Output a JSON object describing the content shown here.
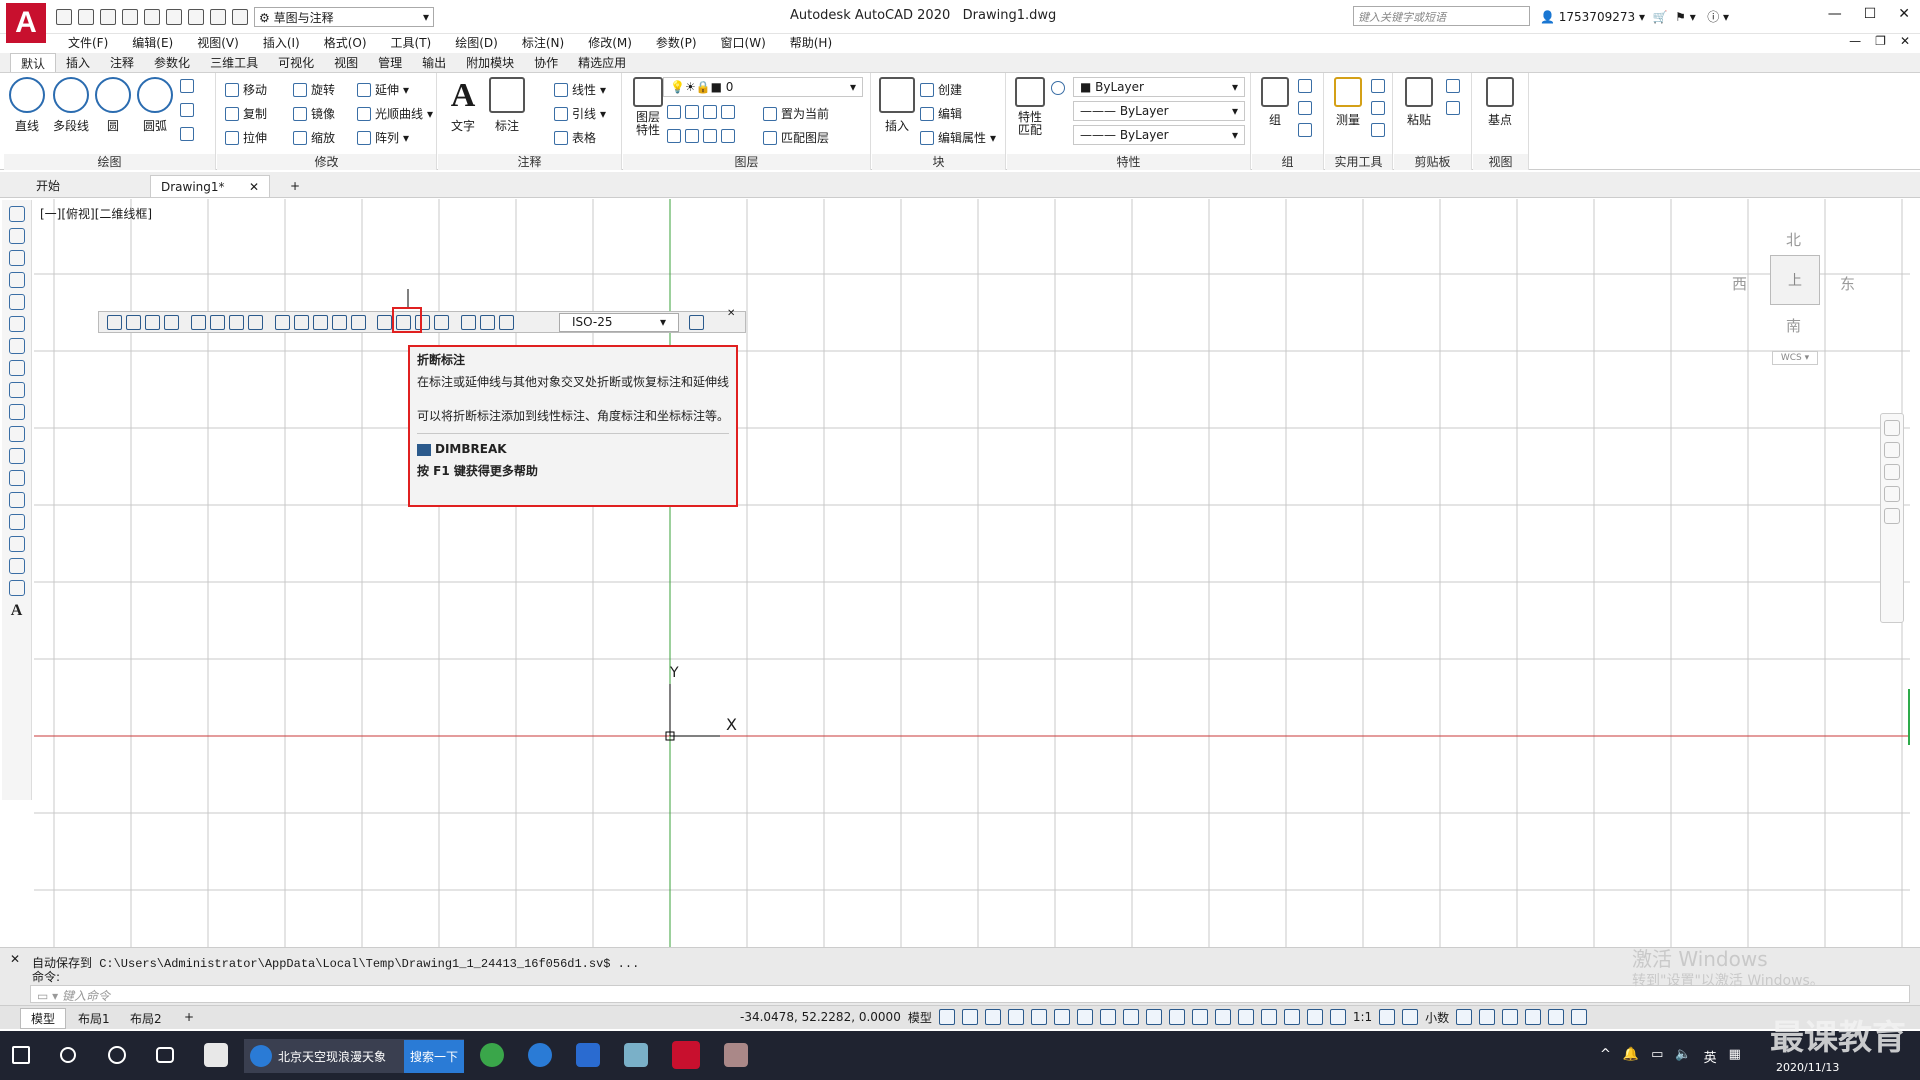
{
  "title": {
    "app": "Autodesk AutoCAD 2020",
    "file": "Drawing1.dwg",
    "workspace": "草图与注释",
    "search_placeholder": "键入关键字或短语",
    "user": "1753709273"
  },
  "menu": [
    "文件(F)",
    "编辑(E)",
    "视图(V)",
    "插入(I)",
    "格式(O)",
    "工具(T)",
    "绘图(D)",
    "标注(N)",
    "修改(M)",
    "参数(P)",
    "窗口(W)",
    "帮助(H)"
  ],
  "ribbon_tabs": [
    "默认",
    "插入",
    "注释",
    "参数化",
    "三维工具",
    "可视化",
    "视图",
    "管理",
    "输出",
    "附加模块",
    "协作",
    "精选应用"
  ],
  "ribbon": {
    "draw": {
      "title": "绘图",
      "line": "直线",
      "polyline": "多段线",
      "circle": "圆",
      "arc": "圆弧"
    },
    "modify": {
      "title": "修改",
      "move": "移动",
      "rotate": "旋转",
      "extend": "延伸",
      "copy": "复制",
      "mirror": "镜像",
      "fillet": "光顺曲线",
      "stretch": "拉伸",
      "scale": "缩放",
      "array": "阵列"
    },
    "annotation": {
      "title": "注释",
      "text": "文字",
      "dim": "标注",
      "linear": "线性",
      "leader": "引线",
      "table": "表格"
    },
    "layers": {
      "title": "图层",
      "props": "图层\n特性",
      "current_layer": "0",
      "set_current": "置为当前",
      "match": "匹配图层"
    },
    "block": {
      "title": "块",
      "insert": "插入",
      "create": "创建",
      "edit": "编辑",
      "attr": "编辑属性"
    },
    "properties": {
      "title": "特性",
      "match": "特性\n匹配",
      "color": "ByLayer",
      "linetype": "ByLayer",
      "lineweight": "ByLayer"
    },
    "groups": {
      "title": "组",
      "group": "组"
    },
    "utilities": {
      "title": "实用工具",
      "measure": "测量"
    },
    "clipboard": {
      "title": "剪贴板",
      "paste": "粘贴"
    },
    "view": {
      "title": "视图",
      "base": "基点"
    }
  },
  "doc_tabs": {
    "start": "开始",
    "drawing": "Drawing1*",
    "add": "+"
  },
  "canvas": {
    "view_label": "[一][俯视][二维线框]",
    "dim_style": "ISO-25",
    "compass": {
      "n": "北",
      "s": "南",
      "e": "东",
      "w": "西",
      "top": "上",
      "wcs": "WCS"
    },
    "axis_x": "X",
    "axis_y": "Y"
  },
  "tooltip": {
    "title": "折断标注",
    "desc1": "在标注或延伸线与其他对象交叉处折断或恢复标注和延伸线",
    "desc2": "可以将折断标注添加到线性标注、角度标注和坐标标注等。",
    "command": "DIMBREAK",
    "help": "按 F1 键获得更多帮助"
  },
  "command": {
    "history": "自动保存到 C:\\Users\\Administrator\\AppData\\Local\\Temp\\Drawing1_1_24413_16f056d1.sv$ ...",
    "prompt": "命令:",
    "placeholder": "键入命令"
  },
  "layout_tabs": [
    "模型",
    "布局1",
    "布局2",
    "+"
  ],
  "status": {
    "coords": "-34.0478, 52.2282, 0.0000",
    "model": "模型",
    "scale": "1:1",
    "units": "小数"
  },
  "watermark": {
    "line1": "激活 Windows",
    "line2": "转到\"设置\"以激活 Windows。"
  },
  "taskbar": {
    "browser_tab": "北京天空现浪漫天象",
    "search_btn": "搜索一下",
    "lang": "英",
    "date": "2020/11/13"
  },
  "brand": "最课教育",
  "colors": {
    "accent": "#c8102e",
    "highlight": "#e02020",
    "grid": "#c8c8c8",
    "xaxis": "#c83a3a",
    "yaxis": "#3aa03a"
  }
}
